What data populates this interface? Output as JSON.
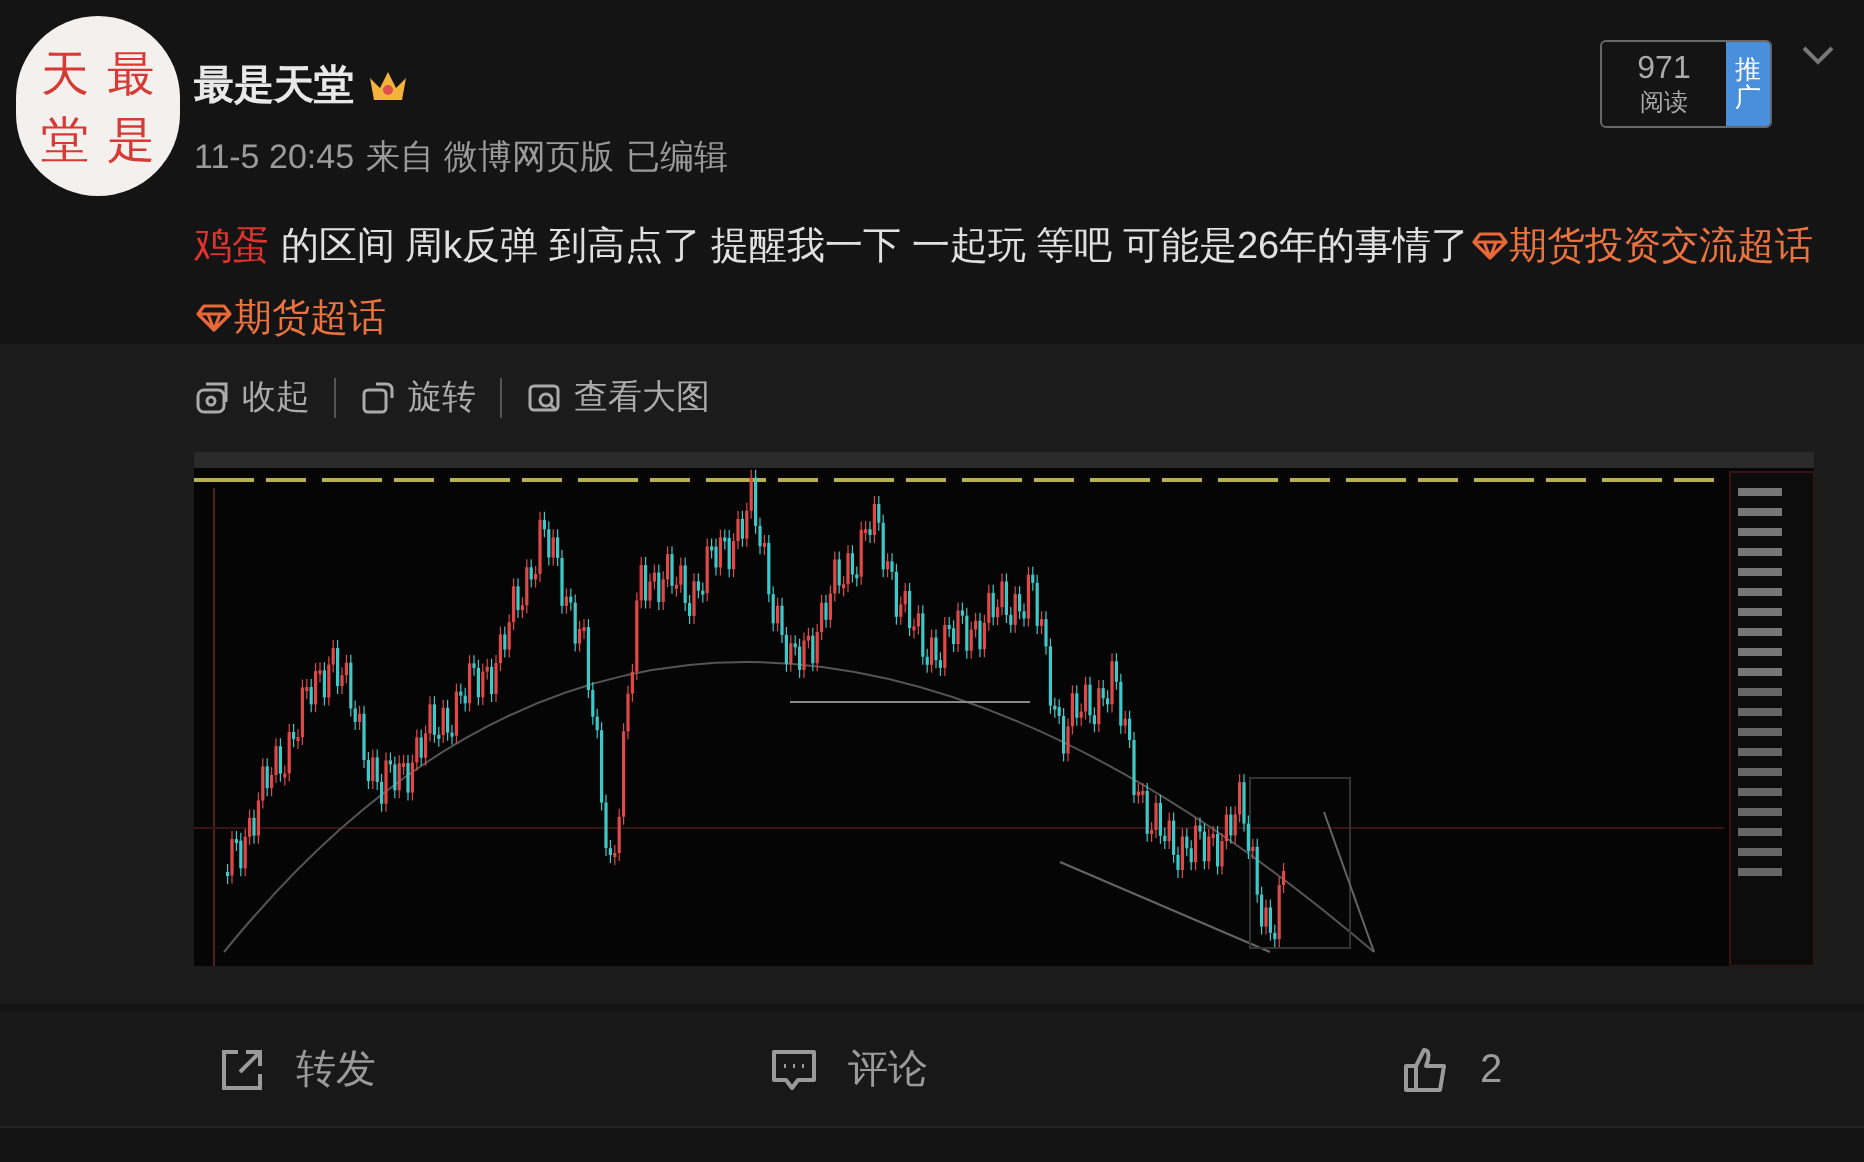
{
  "author": {
    "name": "最是天堂",
    "avatar_chars": [
      "天",
      "堂",
      "最",
      "是"
    ]
  },
  "meta": {
    "time": "11-5 20:45",
    "source": "来自 微博网页版",
    "edited": "已编辑"
  },
  "reads": {
    "count": "971",
    "label": "阅读",
    "promote": "推广"
  },
  "content": [
    {
      "kind": "keyword",
      "text": "鸡蛋"
    },
    {
      "kind": "plain",
      "text": " 的区间 周k反弹  到高点了 提醒我一下 一起玩 等吧 可能是26年的事情了"
    },
    {
      "kind": "topic",
      "text": "期货投资交流超话"
    },
    {
      "kind": "topic",
      "text": "期货超话"
    }
  ],
  "image_toolbar": [
    "收起",
    "旋转",
    "查看大图"
  ],
  "actions": [
    {
      "kind": "repost",
      "label": "转发"
    },
    {
      "kind": "comment",
      "label": "评论"
    },
    {
      "kind": "like",
      "label": "2"
    }
  ]
}
